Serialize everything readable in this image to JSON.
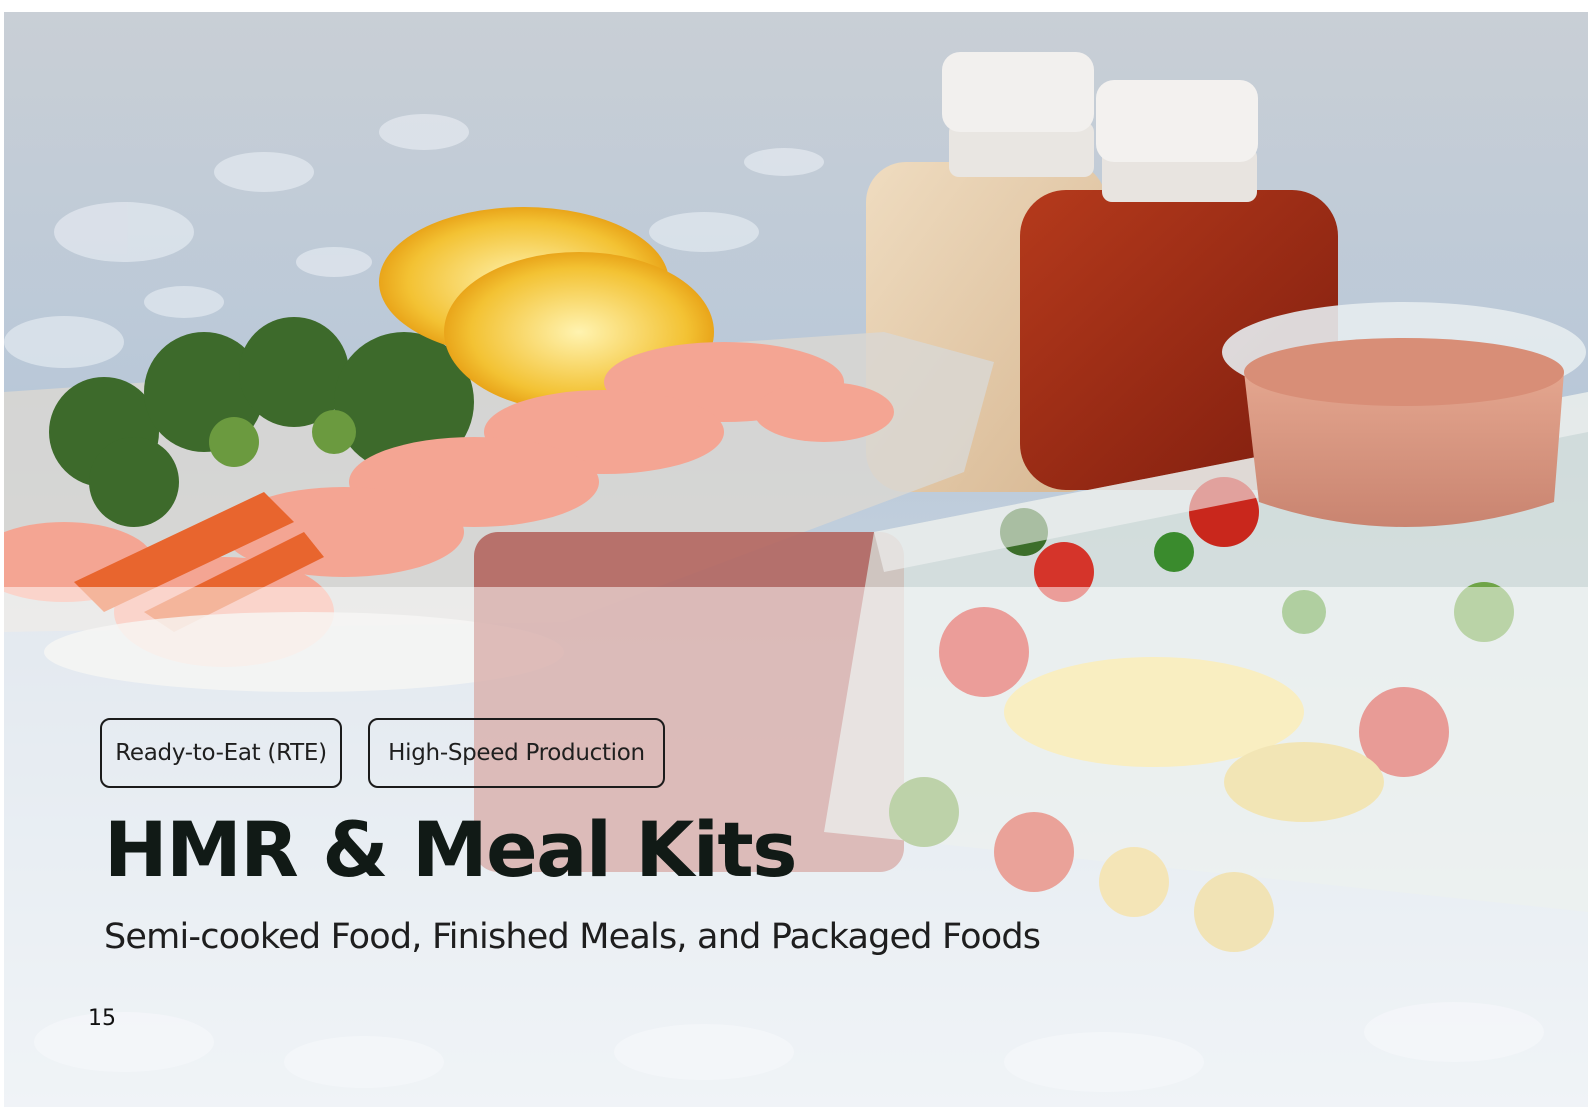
{
  "tags": [
    "Ready-to-Eat (RTE)",
    "High-Speed Production"
  ],
  "title": "HMR & Meal Kits",
  "subtitle": "Semi-cooked Food, Finished Meals, and Packaged Foods",
  "page_number": "15",
  "colors": {
    "title": "#111a16",
    "tag_border": "#1b1b1b",
    "frost_overlay": "rgba(255,255,255,0.52)"
  }
}
